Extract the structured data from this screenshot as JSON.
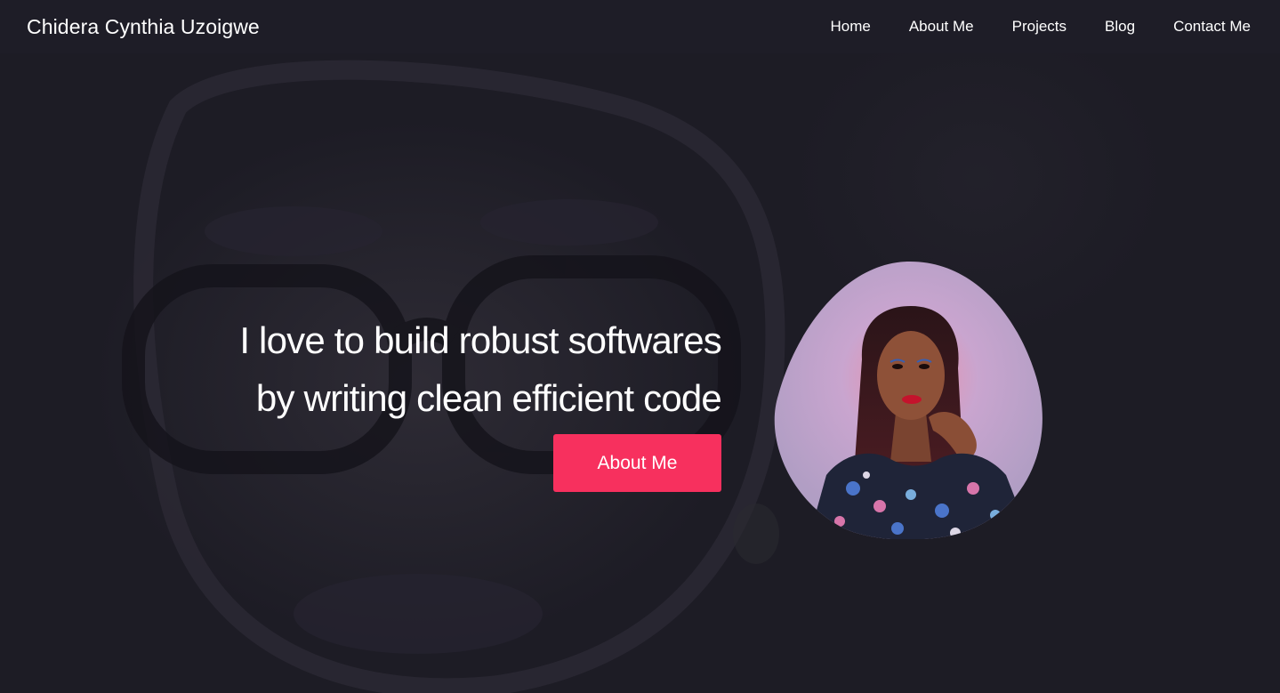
{
  "navbar": {
    "brand": "Chidera Cynthia Uzoigwe",
    "links": [
      {
        "label": "Home"
      },
      {
        "label": "About Me"
      },
      {
        "label": "Projects"
      },
      {
        "label": "Blog"
      },
      {
        "label": "Contact Me"
      }
    ]
  },
  "hero": {
    "headline_line1": "I love to build robust softwares",
    "headline_line2": "by writing clean efficient code",
    "cta_label": "About Me"
  },
  "colors": {
    "background": "#1d1c25",
    "accent": "#f7305e",
    "portrait_backdrop": "#b9a3c9"
  }
}
